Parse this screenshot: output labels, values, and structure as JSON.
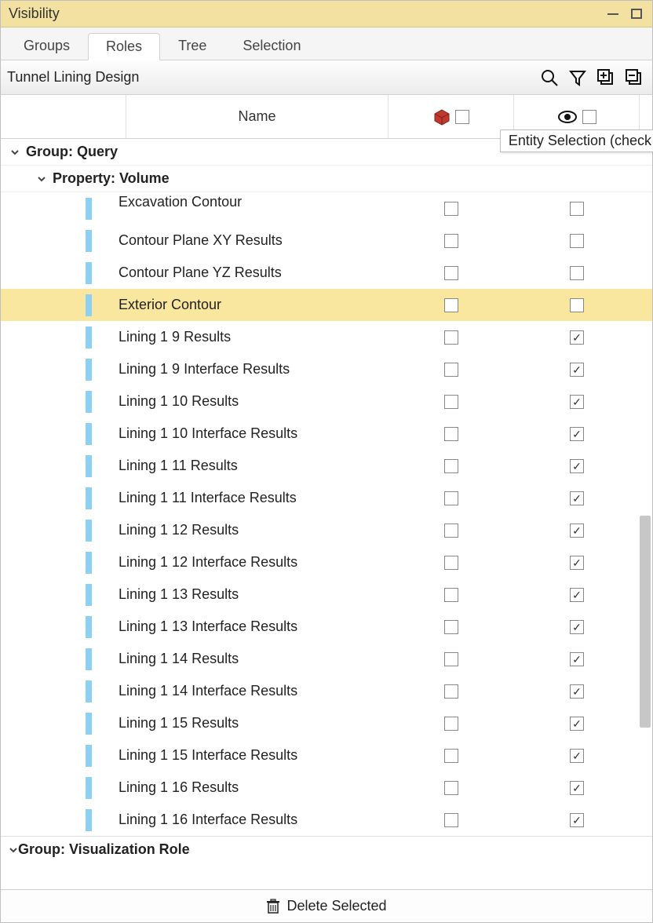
{
  "window": {
    "title": "Visibility"
  },
  "tabs": [
    {
      "label": "Groups",
      "active": false
    },
    {
      "label": "Roles",
      "active": true
    },
    {
      "label": "Tree",
      "active": false
    },
    {
      "label": "Selection",
      "active": false
    }
  ],
  "subtitle": "Tunnel Lining Design",
  "columns": {
    "name": "Name"
  },
  "tooltip": "Entity Selection (check",
  "group1": {
    "label": "Group: Query"
  },
  "property1": {
    "label": "Property: Volume"
  },
  "items": [
    {
      "name": "Excavation Contour",
      "c1": false,
      "c2": false,
      "highlight": false,
      "cut": true
    },
    {
      "name": "Contour Plane XY Results",
      "c1": false,
      "c2": false,
      "highlight": false
    },
    {
      "name": "Contour Plane YZ Results",
      "c1": false,
      "c2": false,
      "highlight": false
    },
    {
      "name": "Exterior Contour",
      "c1": false,
      "c2": false,
      "highlight": true
    },
    {
      "name": "Lining 1 9 Results",
      "c1": false,
      "c2": true,
      "highlight": false
    },
    {
      "name": "Lining 1 9 Interface Results",
      "c1": false,
      "c2": true,
      "highlight": false
    },
    {
      "name": "Lining 1 10 Results",
      "c1": false,
      "c2": true,
      "highlight": false
    },
    {
      "name": "Lining 1 10 Interface Results",
      "c1": false,
      "c2": true,
      "highlight": false
    },
    {
      "name": "Lining 1 11 Results",
      "c1": false,
      "c2": true,
      "highlight": false
    },
    {
      "name": "Lining 1 11 Interface Results",
      "c1": false,
      "c2": true,
      "highlight": false
    },
    {
      "name": "Lining 1 12 Results",
      "c1": false,
      "c2": true,
      "highlight": false
    },
    {
      "name": "Lining 1 12 Interface Results",
      "c1": false,
      "c2": true,
      "highlight": false
    },
    {
      "name": "Lining 1 13 Results",
      "c1": false,
      "c2": true,
      "highlight": false
    },
    {
      "name": "Lining 1 13 Interface Results",
      "c1": false,
      "c2": true,
      "highlight": false
    },
    {
      "name": "Lining 1 14 Results",
      "c1": false,
      "c2": true,
      "highlight": false
    },
    {
      "name": "Lining 1 14 Interface Results",
      "c1": false,
      "c2": true,
      "highlight": false
    },
    {
      "name": "Lining 1 15 Results",
      "c1": false,
      "c2": true,
      "highlight": false
    },
    {
      "name": "Lining 1 15 Interface Results",
      "c1": false,
      "c2": true,
      "highlight": false
    },
    {
      "name": "Lining 1 16 Results",
      "c1": false,
      "c2": true,
      "highlight": false
    },
    {
      "name": "Lining 1 16 Interface Results",
      "c1": false,
      "c2": true,
      "highlight": false
    }
  ],
  "group2": {
    "label": "Group: Visualization Role"
  },
  "footer": {
    "delete": "Delete Selected"
  }
}
